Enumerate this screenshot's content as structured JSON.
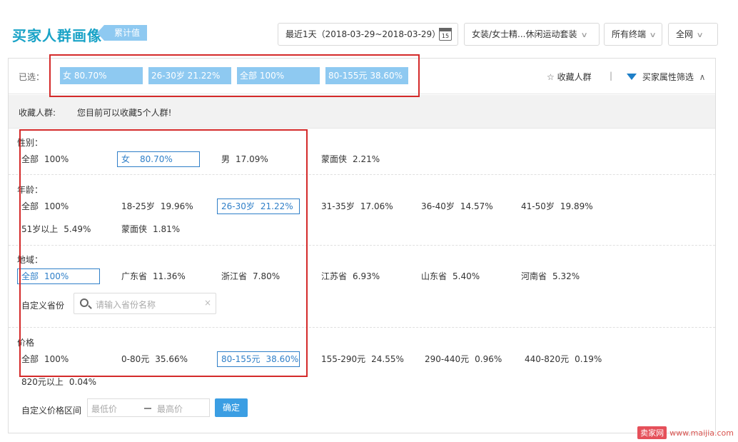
{
  "header": {
    "title": "买家人群画像",
    "badge": "累计值",
    "date_range": "最近1天（2018-03-29~2018-03-29）",
    "calendar_day": "15",
    "category": "女装/女士精...休闲运动套装",
    "terminal": "所有终端",
    "network": "全网"
  },
  "selected": {
    "label": "已选：",
    "chips": [
      "女 80.70%",
      "26-30岁 21.22%",
      "全部 100%",
      "80-155元 38.60%"
    ],
    "favorite_link": "收藏人群",
    "separator": "|",
    "filter_link": "买家属性筛选"
  },
  "favorites": {
    "label": "收藏人群:",
    "message": "您目前可以收藏5个人群!"
  },
  "sections": {
    "gender": {
      "label": "性别：",
      "options": [
        {
          "name": "全部",
          "pct": "100%"
        },
        {
          "name": "女",
          "pct": "80.70%"
        },
        {
          "name": "男",
          "pct": "17.09%"
        },
        {
          "name": "蒙面侠",
          "pct": "2.21%"
        }
      ]
    },
    "age": {
      "label": "年龄：",
      "options": [
        {
          "name": "全部",
          "pct": "100%"
        },
        {
          "name": "18-25岁",
          "pct": "19.96%"
        },
        {
          "name": "26-30岁",
          "pct": "21.22%"
        },
        {
          "name": "31-35岁",
          "pct": "17.06%"
        },
        {
          "name": "36-40岁",
          "pct": "14.57%"
        },
        {
          "name": "41-50岁",
          "pct": "19.89%"
        },
        {
          "name": "51岁以上",
          "pct": "5.49%"
        },
        {
          "name": "蒙面侠",
          "pct": "1.81%"
        }
      ]
    },
    "region": {
      "label": "地域：",
      "options": [
        {
          "name": "全部",
          "pct": "100%"
        },
        {
          "name": "广东省",
          "pct": "11.36%"
        },
        {
          "name": "浙江省",
          "pct": "7.80%"
        },
        {
          "name": "江苏省",
          "pct": "6.93%"
        },
        {
          "name": "山东省",
          "pct": "5.40%"
        },
        {
          "name": "河南省",
          "pct": "5.32%"
        }
      ],
      "custom_label": "自定义省份",
      "search_placeholder": "请输入省份名称",
      "clear": "×"
    },
    "price": {
      "label": "价格",
      "options": [
        {
          "name": "全部",
          "pct": "100%"
        },
        {
          "name": "0-80元",
          "pct": "35.66%"
        },
        {
          "name": "80-155元",
          "pct": "38.60%"
        },
        {
          "name": "155-290元",
          "pct": "24.55%"
        },
        {
          "name": "290-440元",
          "pct": "0.96%"
        },
        {
          "name": "440-820元",
          "pct": "0.19%"
        },
        {
          "name": "820元以上",
          "pct": "0.04%"
        }
      ],
      "custom_label": "自定义价格区间",
      "min_placeholder": "最低价",
      "max_placeholder": "最高价",
      "confirm": "确定"
    }
  },
  "watermark": {
    "brand": "卖家网",
    "url": "www.maijia.com"
  },
  "colors": {
    "title": "#1aa3c7",
    "chip": "#8ec9f1",
    "selected_border": "#2f7fc8",
    "highlight": "#d42a2a",
    "confirm_button": "#3b9ee3"
  }
}
